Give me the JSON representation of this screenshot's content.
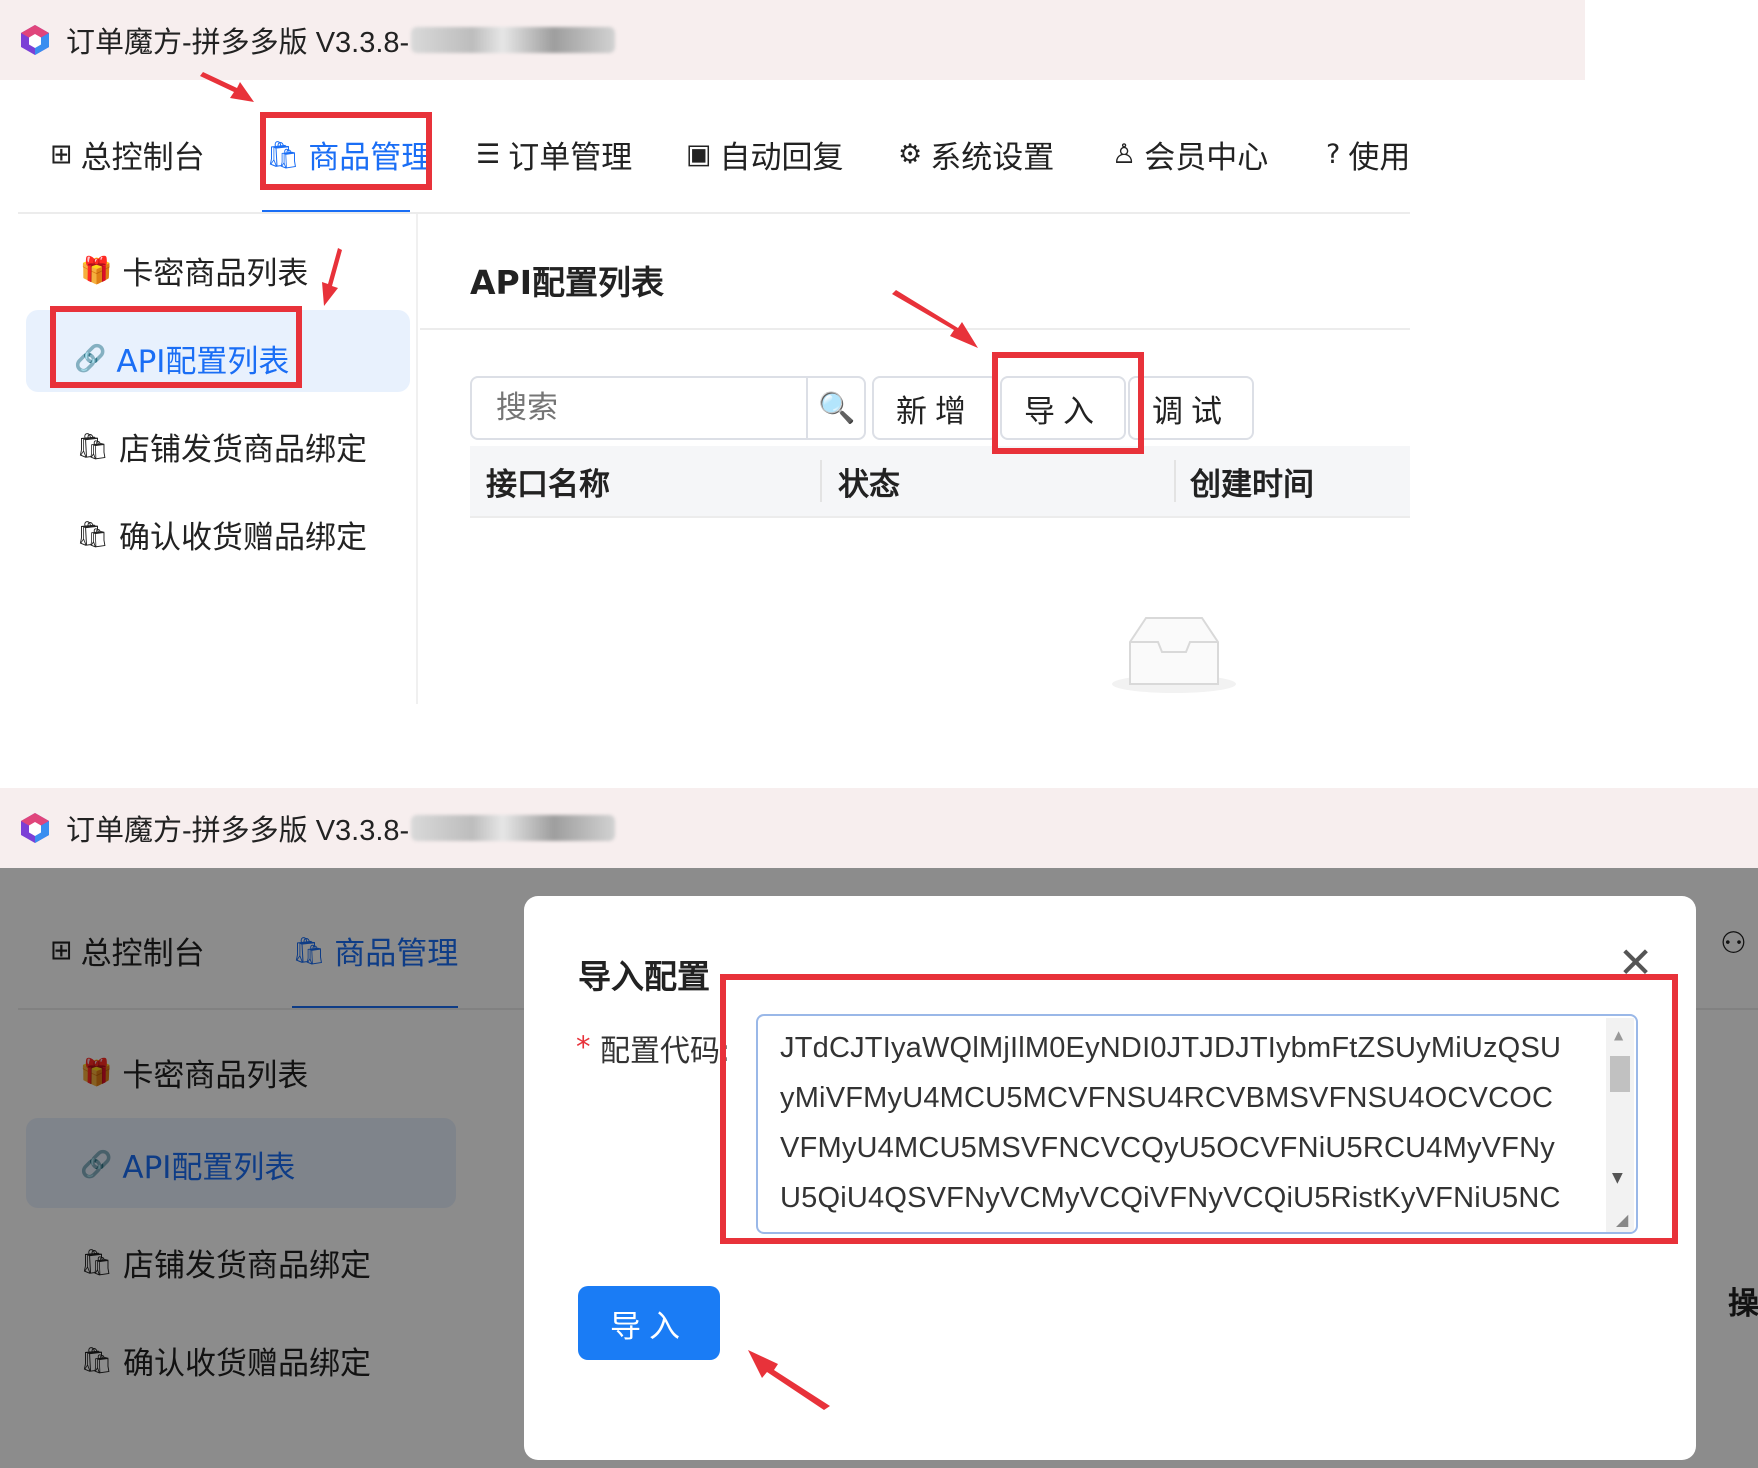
{
  "app": {
    "title": "订单魔方-拼多多版 V3.3.8-"
  },
  "nav": {
    "items": [
      {
        "label": "总控制台",
        "icon": "dashboard-icon"
      },
      {
        "label": "商品管理",
        "icon": "bag-icon"
      },
      {
        "label": "订单管理",
        "icon": "list-icon"
      },
      {
        "label": "自动回复",
        "icon": "robot-icon"
      },
      {
        "label": "系统设置",
        "icon": "gear-icon"
      },
      {
        "label": "会员中心",
        "icon": "user-icon"
      },
      {
        "label": "使用",
        "icon": "help-icon"
      }
    ]
  },
  "sidebar": {
    "items": [
      {
        "label": "卡密商品列表",
        "icon": "gift-icon"
      },
      {
        "label": "API配置列表",
        "icon": "link-icon"
      },
      {
        "label": "店铺发货商品绑定",
        "icon": "bag-icon"
      },
      {
        "label": "确认收货赠品绑定",
        "icon": "bag-icon"
      }
    ]
  },
  "content": {
    "title": "API配置列表",
    "search_placeholder": "搜索",
    "buttons": {
      "add": "新增",
      "import": "导入",
      "debug": "调试"
    },
    "table": {
      "columns": [
        "接口名称",
        "状态",
        "创建时间"
      ]
    },
    "right_cut_label": "操"
  },
  "modal": {
    "title": "导入配置",
    "required_mark": "*",
    "field_label": "配置代码:",
    "code_lines": [
      "JTdCJTIyaWQlMjIlM0EyNDI0JTJDJTIybmFtZSUyMiUzQSU",
      "yMiVFMyU4MCU5MCVFNSU4RCVBMSVFNSU4OCVCOC",
      "VFMyU4MCU5MSVFNCVCQyU5OCVFNiU5RCU4MyVFNy",
      "U5QiU4QSVFNyVCMyVCQiVFNyVCQiU5RistKyVFNiU5NC"
    ],
    "submit_label": "导入",
    "close_icon": "close-icon"
  },
  "colors": {
    "accent": "#1a6ef5",
    "annotation_red": "#e8323a",
    "primary_button": "#1a7cf5"
  }
}
